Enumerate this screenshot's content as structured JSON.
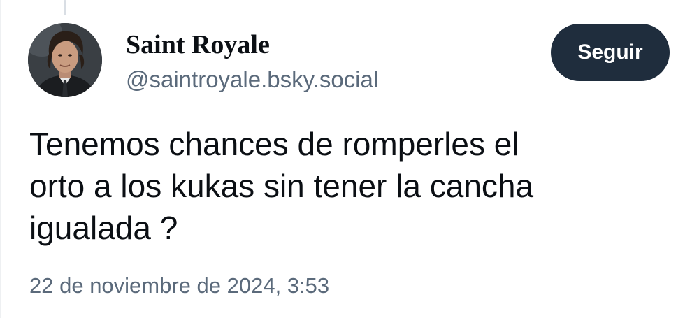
{
  "post": {
    "author": {
      "display_name": "Saint Royale",
      "handle": "@saintroyale.bsky.social"
    },
    "follow_label": "Seguir",
    "text_lines": [
      "Tenemos chances de romperles el",
      "orto a los kukas sin tener la cancha",
      "igualada ?"
    ],
    "timestamp": "22 de noviembre de 2024, 3:53"
  },
  "colors": {
    "text_primary": "#0b0f14",
    "text_secondary": "#5b6a7b",
    "button_bg": "#1f2d3d",
    "button_text": "#ffffff",
    "thread_line": "#d9dee4"
  }
}
